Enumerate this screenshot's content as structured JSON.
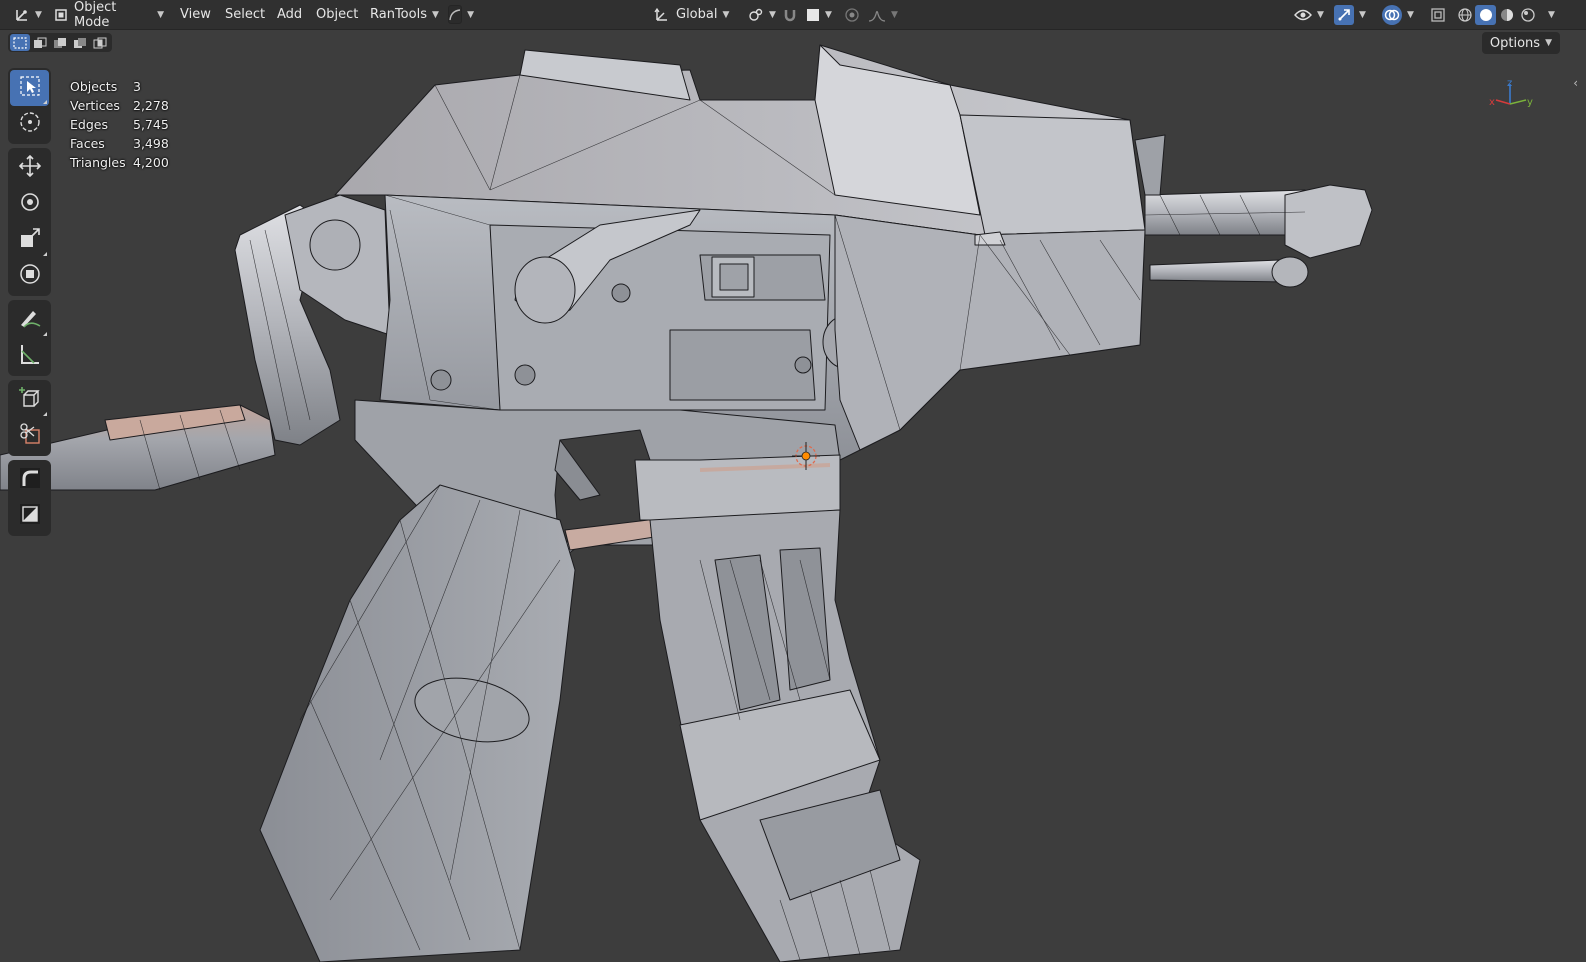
{
  "header": {
    "editor_type_icon": "axes-icon",
    "mode": "Object Mode",
    "menus": [
      "View",
      "Select",
      "Add",
      "Object",
      "RanTools"
    ],
    "orientation": "Global"
  },
  "viewport_options": {
    "label": "Options"
  },
  "stats": [
    {
      "label": "Objects",
      "value": "3"
    },
    {
      "label": "Vertices",
      "value": "2,278"
    },
    {
      "label": "Edges",
      "value": "5,745"
    },
    {
      "label": "Faces",
      "value": "3,498"
    },
    {
      "label": "Triangles",
      "value": "4,200"
    }
  ],
  "gizmo": {
    "x": "x",
    "y": "y",
    "z": "z"
  },
  "tools": [
    "select-box-icon",
    "cursor-icon",
    "move-icon",
    "rotate-icon",
    "scale-icon",
    "transform-icon",
    "annotate-icon",
    "measure-icon",
    "add-cube-icon",
    "cut-icon",
    "bend-icon",
    "scale-cage-icon"
  ],
  "colors": {
    "accent": "#4772b3",
    "background": "#3d3d3d",
    "header": "#303030",
    "origin": "#ff8c00"
  }
}
